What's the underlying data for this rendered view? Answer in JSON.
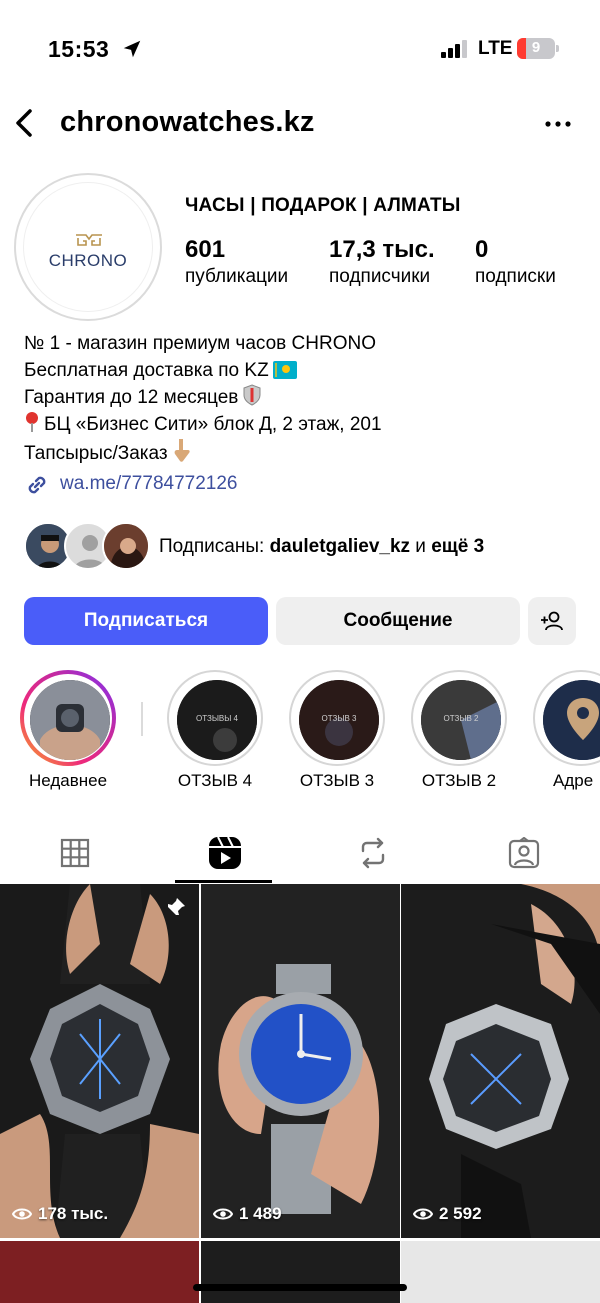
{
  "status_bar": {
    "time": "15:53",
    "network": "LTE",
    "battery": "9"
  },
  "header": {
    "username": "chronowatches.kz"
  },
  "profile": {
    "avatar_text": "CHRONO",
    "category": "ЧАСЫ | ПОДАРОК | АЛМАТЫ",
    "stats": [
      {
        "value": "601",
        "label": "публикации"
      },
      {
        "value": "17,3 тыс.",
        "label": "подписчики"
      },
      {
        "value": "0",
        "label": "подписки"
      }
    ],
    "bio": [
      "№ 1 - магазин премиум часов CHRONO",
      "Бесплатная доставка по KZ",
      "Гарантия до 12 месяцев",
      "БЦ «Бизнес Сити» блок Д, 2 этаж, 201",
      "Тапсырыс/Заказ"
    ],
    "link": "wa.me/77784772126"
  },
  "followed_by": {
    "prefix": "Подписаны: ",
    "user": "dauletgaliev_kz",
    "middle": " и ",
    "rest": "ещё 3"
  },
  "buttons": {
    "follow": "Подписаться",
    "message": "Сообщение"
  },
  "highlights": [
    {
      "name": "Недавнее",
      "label": ""
    },
    {
      "name": "ОТЗЫВ 4",
      "label": "ОТЗЫВЫ 4"
    },
    {
      "name": "ОТЗЫВ 3",
      "label": "ОТЗЫВ 3"
    },
    {
      "name": "ОТЗЫВ 2",
      "label": "ОТЗЫВ 2"
    },
    {
      "name": "Адре",
      "label": ""
    }
  ],
  "grid": [
    {
      "views": "178 тыс."
    },
    {
      "views": "1 489"
    },
    {
      "views": "2 592"
    }
  ],
  "colors": {
    "follow_button": "#4a5df9",
    "link": "#3d4f9e",
    "secondary_button": "#efefef"
  }
}
